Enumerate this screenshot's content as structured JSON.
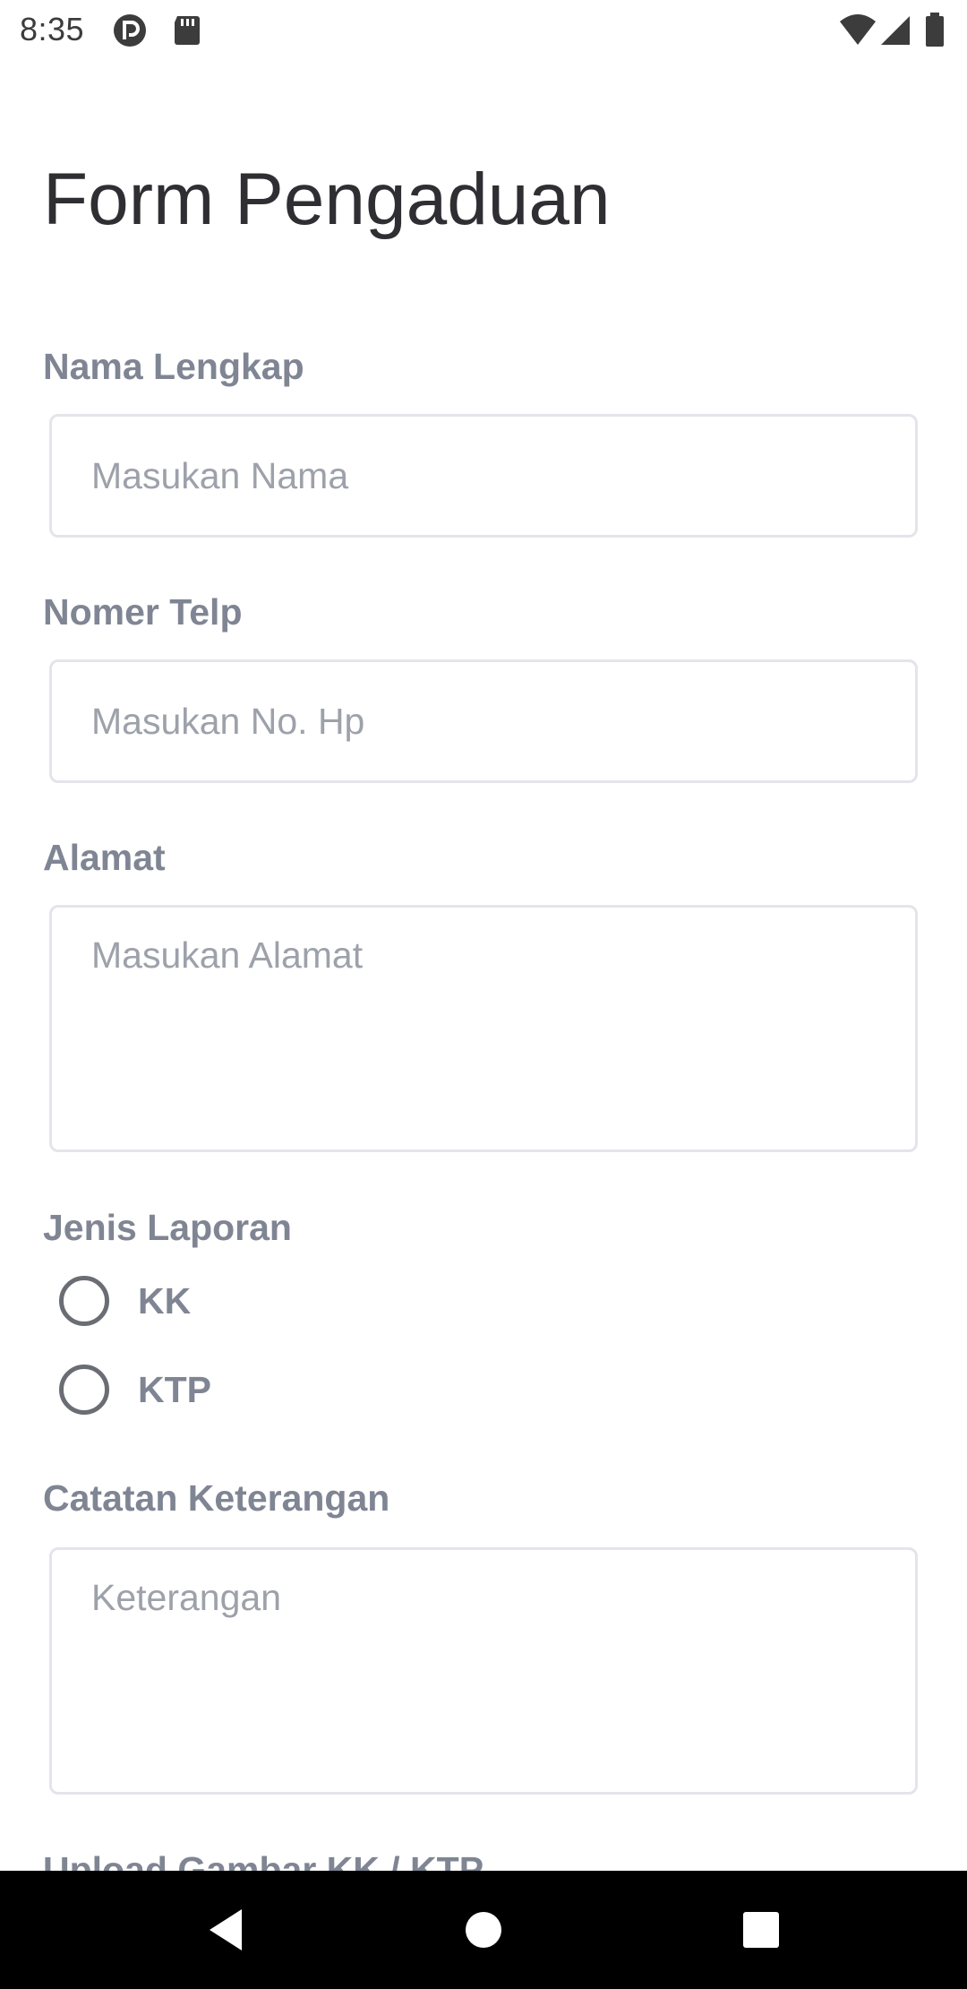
{
  "status_bar": {
    "time": "8:35",
    "icons": [
      "app-notification-icon",
      "sd-card-icon",
      "wifi-icon",
      "signal-icon",
      "battery-icon"
    ]
  },
  "form": {
    "title": "Form Pengaduan",
    "nama": {
      "label": "Nama Lengkap",
      "placeholder": "Masukan Nama",
      "value": ""
    },
    "telp": {
      "label": "Nomer Telp",
      "placeholder": "Masukan No. Hp",
      "value": ""
    },
    "alamat": {
      "label": "Alamat",
      "placeholder": "Masukan Alamat",
      "value": ""
    },
    "jenis": {
      "label": "Jenis Laporan",
      "options": [
        {
          "label": "KK",
          "selected": false
        },
        {
          "label": "KTP",
          "selected": false
        }
      ]
    },
    "catatan": {
      "label": "Catatan Keterangan",
      "placeholder": "Keterangan",
      "value": ""
    },
    "upload": {
      "label": "Upload Gambar KK / KTP"
    }
  },
  "nav_bar": {
    "buttons": [
      "back-icon",
      "home-icon",
      "recents-icon"
    ]
  },
  "colors": {
    "label": "#7f8593",
    "title": "#2f2f33",
    "input_border": "#e3e5ea",
    "placeholder": "#9da1aa",
    "nav_bg": "#000000"
  }
}
